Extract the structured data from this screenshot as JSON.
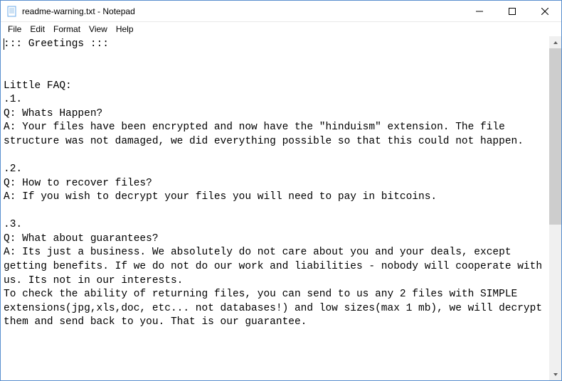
{
  "window": {
    "title": "readme-warning.txt - Notepad"
  },
  "menu": {
    "file": "File",
    "edit": "Edit",
    "format": "Format",
    "view": "View",
    "help": "Help"
  },
  "content": "::: Greetings :::\n\n\nLittle FAQ:\n.1.\nQ: Whats Happen?\nA: Your files have been encrypted and now have the \"hinduism\" extension. The file structure was not damaged, we did everything possible so that this could not happen.\n\n.2.\nQ: How to recover files?\nA: If you wish to decrypt your files you will need to pay in bitcoins.\n\n.3.\nQ: What about guarantees?\nA: Its just a business. We absolutely do not care about you and your deals, except getting benefits. If we do not do our work and liabilities - nobody will cooperate with us. Its not in our interests.\nTo check the ability of returning files, you can send to us any 2 files with SIMPLE extensions(jpg,xls,doc, etc... not databases!) and low sizes(max 1 mb), we will decrypt them and send back to you. That is our guarantee."
}
